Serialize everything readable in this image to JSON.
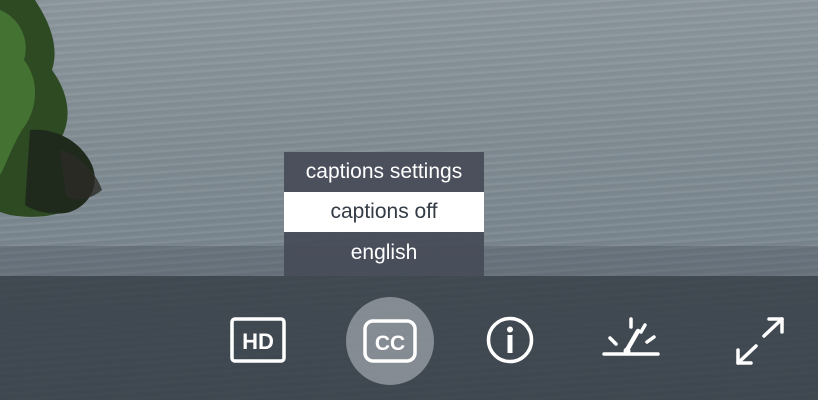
{
  "captions_menu": {
    "header": "captions settings",
    "items": [
      {
        "label": "captions off",
        "selected": true
      },
      {
        "label": "english",
        "selected": false
      }
    ]
  },
  "controls": {
    "hd_label": "HD",
    "cc_label": "CC",
    "cc_active": true,
    "info_icon": "info-icon",
    "speed_icon": "speed-icon",
    "fullscreen_icon": "fullscreen-icon"
  },
  "colors": {
    "control_bar": "#343c44",
    "menu_bg": "#464b58",
    "menu_active_bg": "#ffffff",
    "icon": "#ffffff"
  }
}
